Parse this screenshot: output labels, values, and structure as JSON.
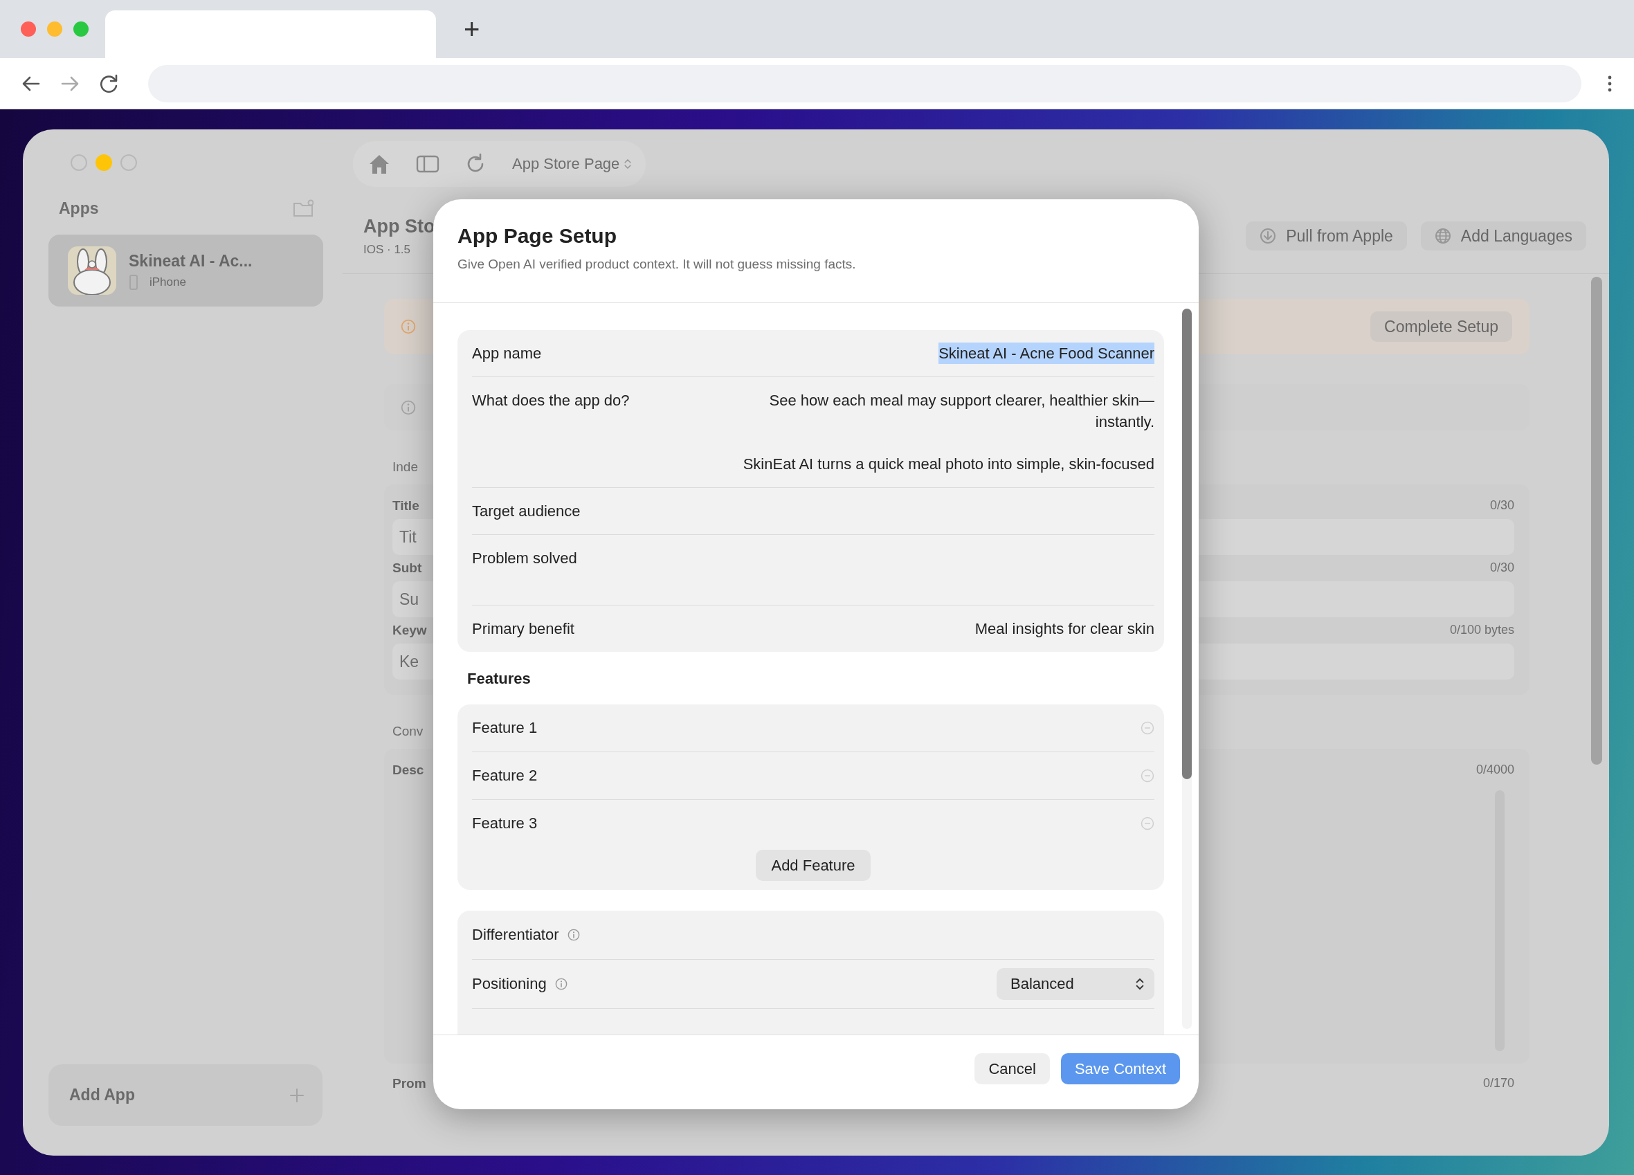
{
  "browser": {
    "new_tab_button": "+"
  },
  "sidebar": {
    "title": "Apps",
    "apps": [
      {
        "name": "Skineat AI - Ac...",
        "platform": "iPhone",
        "selected": true
      }
    ],
    "add_button": "Add App"
  },
  "toolbar": {
    "page_picker": "App Store Page"
  },
  "header": {
    "title": "App Sto",
    "subtitle": "IOS · 1.5",
    "buttons": [
      {
        "label": "Pull from Apple"
      },
      {
        "label": "Add Languages"
      }
    ]
  },
  "setup_banner": {
    "button": "Complete Setup"
  },
  "content": [
    {
      "kind": "section",
      "label": "Inde"
    },
    {
      "kind": "fields",
      "fields": [
        {
          "label": "Title",
          "placeholder": "Tit",
          "counter": "0/30"
        },
        {
          "label": "Subt",
          "placeholder": "Su",
          "counter": "0/30"
        },
        {
          "label": "Keyw",
          "placeholder": "Ke",
          "counter": "0/100 bytes"
        }
      ]
    },
    {
      "kind": "section",
      "label": "Conv"
    },
    {
      "kind": "textarea",
      "label": "Desc",
      "counter": "0/4000"
    },
    {
      "kind": "partial",
      "label": "Prom",
      "counter": "0/170"
    }
  ],
  "dialog": {
    "title": "App Page Setup",
    "subtitle": "Give Open AI verified product context. It will not guess missing facts.",
    "rows": [
      {
        "label": "App name",
        "paragraphs": [
          "Skineat AI - Acne Food Scanner"
        ],
        "highlighted": true
      },
      {
        "label": "What does the app do?",
        "paragraphs": [
          "See how each meal may support clearer, healthier skin—\ninstantly.",
          "SkinEat AI turns a quick meal photo into simple, skin-focused"
        ],
        "highlighted": false
      },
      {
        "label": "Target audience",
        "paragraphs": [],
        "highlighted": false
      },
      {
        "label": "Problem solved",
        "paragraphs": [],
        "highlighted": false,
        "tall": true
      },
      {
        "label": "Primary benefit",
        "paragraphs": [
          "Meal insights for clear skin"
        ],
        "highlighted": false
      }
    ],
    "features": {
      "label": "Features",
      "items": [
        {
          "label": "Feature 1"
        },
        {
          "label": "Feature 2"
        },
        {
          "label": "Feature 3"
        }
      ],
      "add_button": "Add Feature"
    },
    "settings": [
      {
        "label": "Differentiator",
        "info": true
      },
      {
        "label": "Positioning",
        "info": true,
        "select": "Balanced"
      }
    ],
    "buttons": [
      {
        "label": "Cancel",
        "kind": "secondary",
        "disabled": false
      },
      {
        "label": "Save Context",
        "kind": "primary",
        "disabled": true
      }
    ]
  }
}
